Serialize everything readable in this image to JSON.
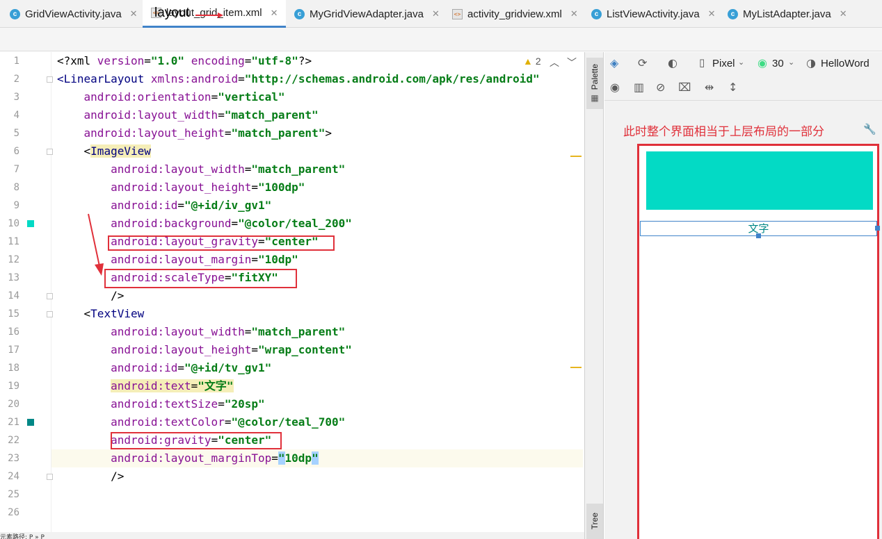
{
  "tabs": [
    {
      "label": "GridViewActivity.java",
      "icon": "java-class-icon"
    },
    {
      "label": "layout_grid_item.xml",
      "icon": "xml-layout-icon",
      "active": true
    },
    {
      "label": "MyGridViewAdapter.java",
      "icon": "java-class-icon"
    },
    {
      "label": "activity_gridview.xml",
      "icon": "xml-layout-icon"
    },
    {
      "label": "ListViewActivity.java",
      "icon": "java-class-icon"
    },
    {
      "label": "MyListAdapter.java",
      "icon": "java-class-icon"
    }
  ],
  "tab_annotation": "layout",
  "editor": {
    "warning_count": "2",
    "lines": [
      {
        "num": "1",
        "parts": [
          [
            "t",
            "<?xml "
          ],
          [
            "a",
            "version"
          ],
          [
            "t",
            "="
          ],
          [
            "v",
            "\"1.0\""
          ],
          [
            "t",
            " "
          ],
          [
            "a",
            "encoding"
          ],
          [
            "t",
            "="
          ],
          [
            "v",
            "\"utf-8\""
          ],
          [
            "t",
            "?>"
          ]
        ]
      },
      {
        "num": "2",
        "parts": [
          [
            "g",
            "<"
          ],
          [
            "g",
            "LinearLayout"
          ],
          [
            "t",
            " "
          ],
          [
            "n",
            "xmlns:android"
          ],
          [
            "t",
            "="
          ],
          [
            "v",
            "\"http://schemas.android.com/apk/res/android\""
          ]
        ]
      },
      {
        "num": "3",
        "parts": [
          [
            "t",
            "    "
          ],
          [
            "a",
            "android:orientation"
          ],
          [
            "t",
            "="
          ],
          [
            "v",
            "\"vertical\""
          ]
        ]
      },
      {
        "num": "4",
        "parts": [
          [
            "t",
            "    "
          ],
          [
            "a",
            "android:layout_width"
          ],
          [
            "t",
            "="
          ],
          [
            "v",
            "\"match_parent\""
          ]
        ]
      },
      {
        "num": "5",
        "parts": [
          [
            "t",
            "    "
          ],
          [
            "a",
            "android:layout_height"
          ],
          [
            "t",
            "="
          ],
          [
            "v",
            "\"match_parent\""
          ],
          [
            "t",
            ">"
          ]
        ]
      },
      {
        "num": "6",
        "parts": [
          [
            "t",
            "    <"
          ],
          [
            "h",
            "ImageView"
          ]
        ]
      },
      {
        "num": "7",
        "parts": [
          [
            "t",
            "        "
          ],
          [
            "a",
            "android:layout_width"
          ],
          [
            "t",
            "="
          ],
          [
            "v",
            "\"match_parent\""
          ]
        ]
      },
      {
        "num": "8",
        "parts": [
          [
            "t",
            "        "
          ],
          [
            "a",
            "android:layout_height"
          ],
          [
            "t",
            "="
          ],
          [
            "v",
            "\"100dp\""
          ]
        ]
      },
      {
        "num": "9",
        "parts": [
          [
            "t",
            "        "
          ],
          [
            "a",
            "android:id"
          ],
          [
            "t",
            "="
          ],
          [
            "v",
            "\"@+id/iv_gv1\""
          ]
        ]
      },
      {
        "num": "10",
        "parts": [
          [
            "t",
            "        "
          ],
          [
            "a",
            "android:background"
          ],
          [
            "t",
            "="
          ],
          [
            "v",
            "\"@color/teal_200\""
          ]
        ]
      },
      {
        "num": "11",
        "parts": [
          [
            "t",
            "        "
          ],
          [
            "a",
            "android:layout_gravity"
          ],
          [
            "t",
            "="
          ],
          [
            "v",
            "\"center\""
          ]
        ]
      },
      {
        "num": "12",
        "parts": [
          [
            "t",
            "        "
          ],
          [
            "a",
            "android:layout_margin"
          ],
          [
            "t",
            "="
          ],
          [
            "v",
            "\"10dp\""
          ]
        ]
      },
      {
        "num": "13",
        "parts": [
          [
            "t",
            "        "
          ],
          [
            "a",
            "android:scaleType"
          ],
          [
            "t",
            "="
          ],
          [
            "v",
            "\"fitXY\""
          ]
        ]
      },
      {
        "num": "14",
        "parts": [
          [
            "t",
            "        />"
          ]
        ]
      },
      {
        "num": "15",
        "parts": [
          [
            "t",
            "    <"
          ],
          [
            "g",
            "TextView"
          ]
        ]
      },
      {
        "num": "16",
        "parts": [
          [
            "t",
            "        "
          ],
          [
            "a",
            "android:layout_width"
          ],
          [
            "t",
            "="
          ],
          [
            "v",
            "\"match_parent\""
          ]
        ]
      },
      {
        "num": "17",
        "parts": [
          [
            "t",
            "        "
          ],
          [
            "a",
            "android:layout_height"
          ],
          [
            "t",
            "="
          ],
          [
            "v",
            "\"wrap_content\""
          ]
        ]
      },
      {
        "num": "18",
        "parts": [
          [
            "t",
            "        "
          ],
          [
            "a",
            "android:id"
          ],
          [
            "t",
            "="
          ],
          [
            "v",
            "\"@+id/tv_gv1\""
          ]
        ]
      },
      {
        "num": "19",
        "parts": [
          [
            "t",
            "        "
          ],
          [
            "ha",
            "android:text"
          ],
          [
            "hx",
            "="
          ],
          [
            "hv",
            "\"文字\""
          ]
        ]
      },
      {
        "num": "20",
        "parts": [
          [
            "t",
            "        "
          ],
          [
            "a",
            "android:textSize"
          ],
          [
            "t",
            "="
          ],
          [
            "v",
            "\"20sp\""
          ]
        ]
      },
      {
        "num": "21",
        "parts": [
          [
            "t",
            "        "
          ],
          [
            "a",
            "android:textColor"
          ],
          [
            "t",
            "="
          ],
          [
            "v",
            "\"@color/teal_700\""
          ]
        ]
      },
      {
        "num": "22",
        "parts": [
          [
            "t",
            "        "
          ],
          [
            "a",
            "android:gravity"
          ],
          [
            "t",
            "="
          ],
          [
            "v",
            "\"center\""
          ]
        ]
      },
      {
        "num": "23",
        "parts": [
          [
            "t",
            "        "
          ],
          [
            "a",
            "android:layout_marginTop"
          ],
          [
            "t",
            "="
          ],
          [
            "b",
            "\""
          ],
          [
            "v",
            "10dp"
          ],
          [
            "b",
            "\""
          ]
        ]
      },
      {
        "num": "24",
        "parts": [
          [
            "t",
            "        />"
          ]
        ]
      },
      {
        "num": "25",
        "parts": []
      },
      {
        "num": "26",
        "parts": []
      }
    ]
  },
  "gutter_colors": {
    "line10": "#03dac5",
    "line21": "#018786"
  },
  "palette_label": "Palette",
  "tree_label": "Tree",
  "design_toolbar": {
    "device": "Pixel",
    "api": "30",
    "theme": "HelloWord"
  },
  "design_note": "此时整个界面相当于上层布局的一部分",
  "preview": {
    "text": "文字",
    "image_color": "#03dac5",
    "text_color": "#018786"
  },
  "statusbar_text": "元素路径: P » P",
  "colors": {
    "annotation_red": "#e0303a",
    "selection_blue": "#4083c9"
  }
}
